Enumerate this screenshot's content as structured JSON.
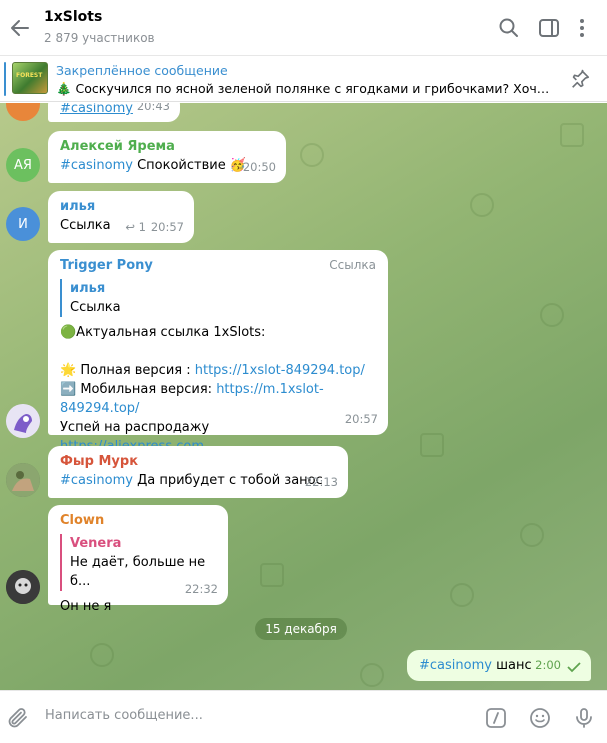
{
  "header": {
    "title": "1xSlots",
    "subtitle": "2 879 участников"
  },
  "pinned": {
    "title": "Закреплённое сообщение",
    "text": "🎄 Соскучился по ясной зеленой полянке с ягодками и грибочками? Хочется...",
    "thumb_label": "FOREST"
  },
  "messages": {
    "m0": {
      "text": "#casinomy",
      "time": "20:43"
    },
    "m1": {
      "avatar": "АЯ",
      "author": "Алексей Ярема",
      "hashtag": "#casinomy",
      "text": " Спокойствие 🥳",
      "time": "20:50"
    },
    "m2": {
      "avatar": "И",
      "author": "илья",
      "text": "Ссылка",
      "replies": "↩ 1",
      "time": "20:57"
    },
    "m3": {
      "author": "Trigger Pony",
      "badge": "Ссылка",
      "quote_name": "илья",
      "quote_text": "Ссылка",
      "line1": "🟢Актуальная ссылка  1xSlots:",
      "line2_label": "🌟 Полная версия : ",
      "line2_link": "https://1xslot-849294.top/",
      "line3_label": "➡️ Мобильная версия: ",
      "line3_link": "https://m.1xslot-849294.top/",
      "line4": "Успей на распродажу",
      "line5_link": "https://aliexpress.com",
      "time": "20:57"
    },
    "m4": {
      "author": "Фыр Мурк",
      "hashtag": "#casinomy",
      "text": " Да прибудет с тобой занос",
      "time": "22:13"
    },
    "m5": {
      "author": "Clown",
      "quote_name": "Venera",
      "quote_text": "Не даёт, больше не б...",
      "text": "Он не я",
      "time": "22:32"
    },
    "date": "15 декабря",
    "m6": {
      "hashtag": "#casinomy",
      "text": " шанс",
      "time": "2:00"
    }
  },
  "composer": {
    "placeholder": "Написать сообщение..."
  },
  "colors": {
    "accent": "#3a8fd0",
    "green_author": "#4fae4e",
    "clown_author": "#e0832a",
    "fyr_author": "#d6553b",
    "outgoing": "#eefee2"
  }
}
